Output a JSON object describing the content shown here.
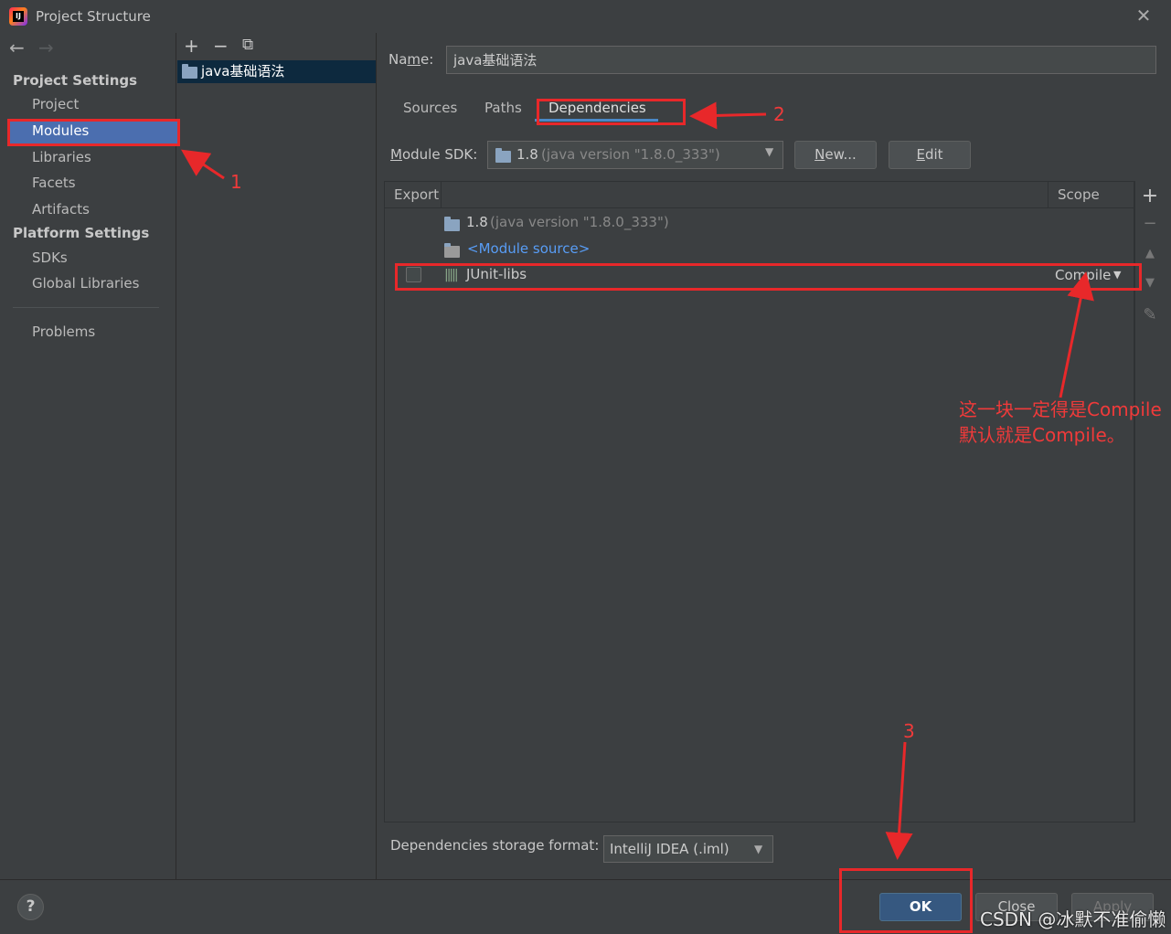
{
  "window": {
    "title": "Project Structure"
  },
  "sidebar": {
    "project_settings_label": "Project Settings",
    "platform_settings_label": "Platform Settings",
    "items": [
      "Project",
      "Modules",
      "Libraries",
      "Facets",
      "Artifacts",
      "SDKs",
      "Global Libraries",
      "Problems"
    ],
    "selected": "Modules"
  },
  "modules": {
    "items": [
      {
        "name": "java基础语法"
      }
    ]
  },
  "detail": {
    "name_label_pre": "Na",
    "name_label_mnemonic": "m",
    "name_label_post": "e:",
    "name_value": "java基础语法",
    "tabs": [
      "Sources",
      "Paths",
      "Dependencies"
    ],
    "active_tab": "Dependencies",
    "sdk_label_mnemonic": "M",
    "sdk_label_rest": "odule SDK:",
    "sdk_version": "1.8",
    "sdk_detail": "(java version \"1.8.0_333\")",
    "new_button_mnemonic": "N",
    "new_button_rest": "ew...",
    "edit_button_mnemonic": "E",
    "edit_button_rest": "dit"
  },
  "dependencies": {
    "headers": {
      "export": "Export",
      "scope": "Scope"
    },
    "rows": [
      {
        "label": "1.8",
        "detail": "(java version \"1.8.0_333\")"
      },
      {
        "label": "<Module source>"
      },
      {
        "label": "JUnit-libs",
        "scope": "Compile",
        "export_checked": false
      }
    ]
  },
  "storage": {
    "label": "Dependencies storage format:",
    "value": "IntelliJ IDEA (.iml)"
  },
  "buttons": {
    "ok": "OK",
    "close": "Close",
    "apply": "Apply",
    "help": "?"
  },
  "annotations": {
    "step1": "1",
    "step2": "2",
    "step3": "3",
    "note_line1": "这一块一定得是Compile",
    "note_line2": "默认就是Compile。",
    "watermark": "CSDN @冰默不准偷懒"
  },
  "colors": {
    "accent": "#4b6eaf",
    "annotation": "#e8282a",
    "link": "#589df6"
  }
}
